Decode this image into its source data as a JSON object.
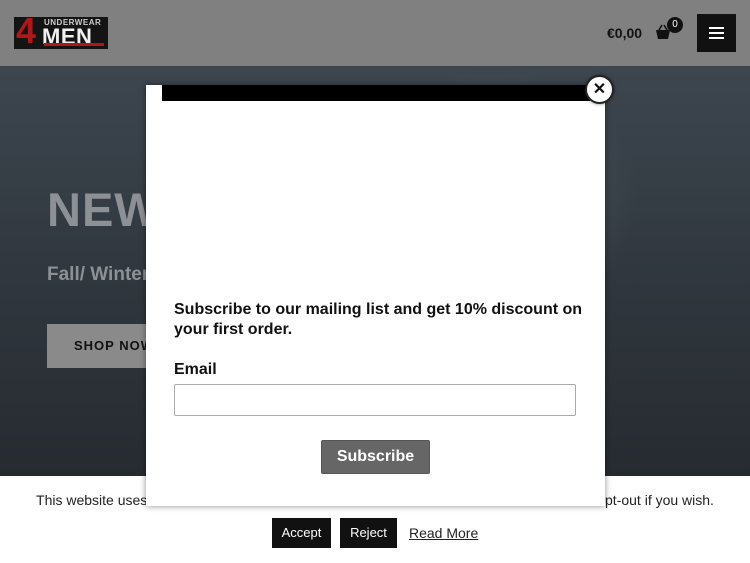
{
  "header": {
    "logo": {
      "numeral": "4",
      "top_text": "UNDERWEAR",
      "main_text": "MEN"
    },
    "cart": {
      "total": "€0,00",
      "count": "0",
      "icon": "shopping-basket-icon"
    },
    "menu_icon": "hamburger-menu-icon"
  },
  "hero": {
    "title": "NEW",
    "subtitle": "Fall/ Winter",
    "button_label": "SHOP NOW"
  },
  "cookie_bar": {
    "text_left": "This website uses coo",
    "text_right": "an opt-out if you wish.",
    "accept_label": "Accept",
    "reject_label": "Reject",
    "read_more_label": "Read More"
  },
  "modal": {
    "close_symbol": "✕",
    "message": "Subscribe to our mailing list and get 10% discount on your first order.",
    "email_label": "Email",
    "email_value": "",
    "subscribe_label": "Subscribe"
  },
  "colors": {
    "header_bg": "#808080",
    "hero_bg": "#2f363d",
    "button_dark": "#111111",
    "subscribe_bg": "#666666",
    "logo_red": "#b01818"
  }
}
